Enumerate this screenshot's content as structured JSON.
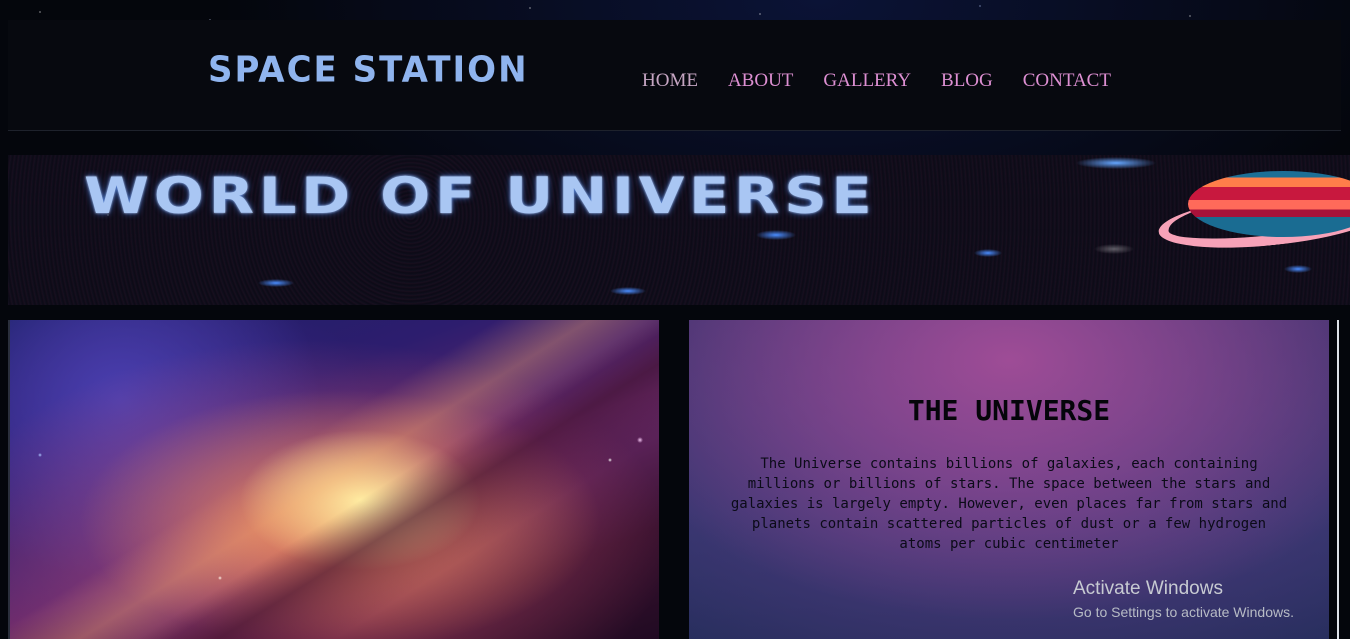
{
  "header": {
    "logo": "SPACE STATION",
    "nav": [
      "HOME",
      "ABOUT",
      "GALLERY",
      "BLOG",
      "CONTACT"
    ]
  },
  "banner": {
    "title": "WORLD OF UNIVERSE"
  },
  "universe": {
    "title": "THE UNIVERSE",
    "text": "The Universe contains billions of galaxies, each containing millions or billions of stars. The space between the stars and galaxies is largely empty. However, even places far from stars and planets contain scattered particles of dust or a few hydrogen atoms per cubic centimeter"
  },
  "os_overlay": {
    "title": "Activate Windows",
    "subtitle": "Go to Settings to activate Windows."
  },
  "colors": {
    "logo": "#8fb4ee",
    "nav_link": "#dd8fd2",
    "banner_title": "#a9c6f3"
  },
  "icons": [
    "planet-illustration",
    "galaxy-image"
  ]
}
